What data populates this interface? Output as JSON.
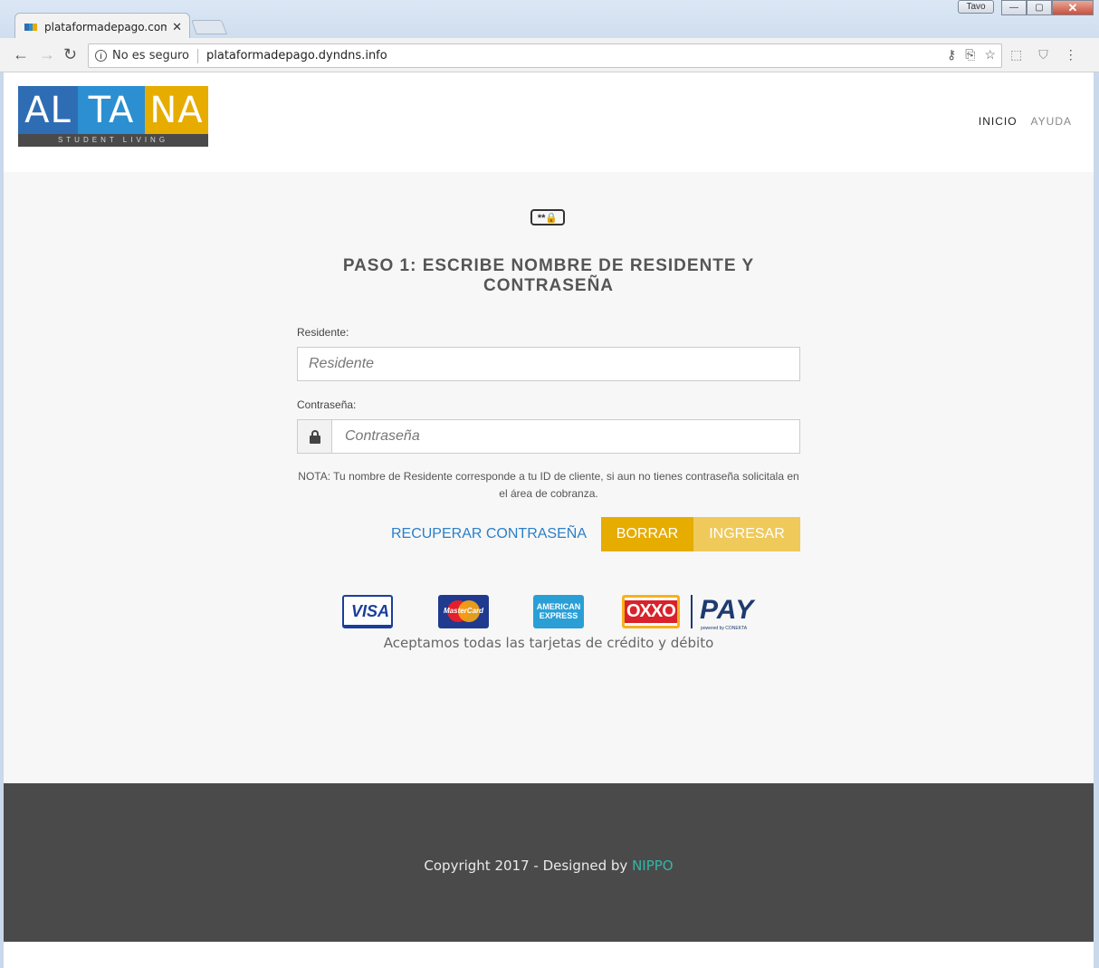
{
  "browser": {
    "tab_title": "plataformadepago.com.m",
    "tab_close": "✕",
    "user": "Tavo",
    "security_label": "No es seguro",
    "url": "plataformadepago.dyndns.info"
  },
  "logo": {
    "parts": [
      "AL",
      "TA",
      "NA"
    ],
    "tagline": "STUDENT LIVING",
    "colors": [
      "#2e6db3",
      "#2b8fd1",
      "#e6ac00"
    ]
  },
  "nav": {
    "inicio": "INICIO",
    "ayuda": "AYUDA"
  },
  "form": {
    "icon_text": "**🔒",
    "title": "PASO 1: ESCRIBE NOMBRE DE RESIDENTE Y CONTRASEÑA",
    "resident_label": "Residente:",
    "resident_placeholder": "Residente",
    "password_label": "Contraseña:",
    "password_placeholder": "Contraseña",
    "note": "NOTA: Tu nombre de Residente corresponde a tu ID de cliente, si aun no tienes contraseña solicitala en el área de cobranza.",
    "recover_link": "RECUPERAR CONTRASEÑA",
    "clear_button": "BORRAR",
    "login_button": "INGRESAR"
  },
  "payments": {
    "visa": "VISA",
    "mastercard": "MasterCard",
    "amex": "AMERICAN EXPRESS",
    "oxxo": "OXXO",
    "pay": "PAY",
    "pay_sub": "powered by CONEKTA",
    "caption": "Aceptamos todas las tarjetas de crédito y débito"
  },
  "footer": {
    "copyright": "Copyright 2017 - Designed by",
    "designer": "NIPPO"
  },
  "colors": {
    "accent_yellow": "#e6ac00",
    "link_blue": "#2b7fc8",
    "footer_bg": "#4a4a4a",
    "designer_teal": "#35b6a7"
  }
}
